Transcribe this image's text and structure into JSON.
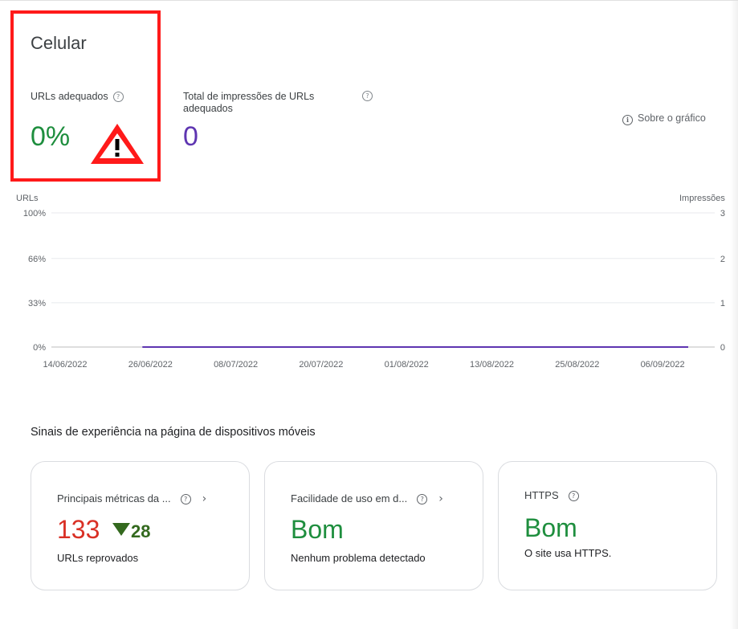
{
  "header": {
    "device_title": "Celular",
    "metrics": [
      {
        "label": "URLs adequados",
        "value": "0%"
      },
      {
        "label": "Total de impressões de URLs adequados",
        "value": "0"
      }
    ],
    "about_chart": "Sobre o gráfico",
    "help_glyph": "?",
    "info_glyph": "i"
  },
  "chart_data": {
    "type": "line",
    "left_axis_title": "URLs",
    "right_axis_title": "Impressões",
    "left_ticks": [
      "100%",
      "66%",
      "33%",
      "0%"
    ],
    "right_ticks": [
      "3",
      "2",
      "1",
      "0"
    ],
    "x_ticks": [
      "14/06/2022",
      "26/06/2022",
      "08/07/2022",
      "20/07/2022",
      "01/08/2022",
      "13/08/2022",
      "25/08/2022",
      "06/09/2022"
    ],
    "ylim_left": [
      0,
      100
    ],
    "ylim_right": [
      0,
      3
    ],
    "grid": true,
    "series": [
      {
        "color": "#5e35b1",
        "x_start": "26/06/2022",
        "x_end": "09/09/2022",
        "y": 0
      }
    ]
  },
  "section": {
    "title": "Sinais de experiência na página de dispositivos móveis",
    "cards": [
      {
        "title": "Principais métricas da ...",
        "value": "133",
        "delta": "28",
        "subtitle": "URLs reprovados",
        "has_chevron": true
      },
      {
        "title": "Facilidade de uso em d...",
        "value": "Bom",
        "subtitle": "Nenhum problema detectado",
        "has_chevron": true
      },
      {
        "title": "HTTPS",
        "value": "Bom",
        "subtitle": "O site usa HTTPS.",
        "has_chevron": false
      }
    ],
    "chevron_glyph": "›"
  },
  "colors": {
    "good_green": "#1e8e3e",
    "poor_red": "#d93025",
    "impressions_purple": "#5e35b1",
    "highlight_red": "#ff1a1a",
    "delta_green": "#33691e"
  }
}
